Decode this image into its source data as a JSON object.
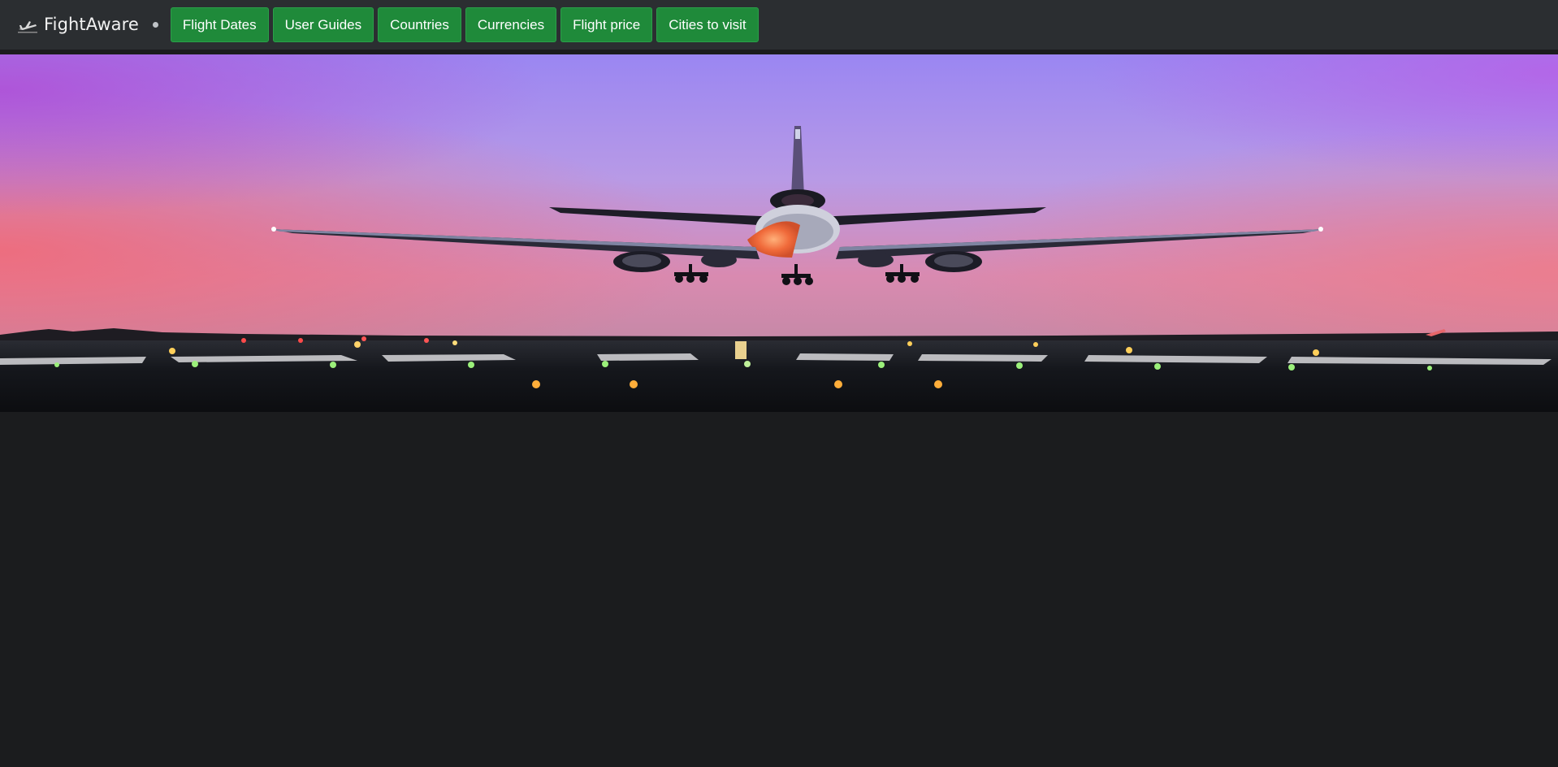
{
  "brand": {
    "name": "FightAware",
    "logo_icon": "plane-icon"
  },
  "nav": {
    "items": [
      {
        "label": "Flight Dates"
      },
      {
        "label": "User Guides"
      },
      {
        "label": "Countries"
      },
      {
        "label": "Currencies"
      },
      {
        "label": "Flight price"
      },
      {
        "label": "Cities to visit"
      }
    ]
  },
  "hero": {
    "image_subject": "airplane landing on runway at dusk",
    "image_icon": "hero-plane-landing-image"
  },
  "colors": {
    "navbar_bg": "#2b2e31",
    "page_bg": "#1b1c1e",
    "button_bg": "#1f8a3a",
    "sky_top": "#9a7df0",
    "sky_horizon": "#e86a8a"
  }
}
